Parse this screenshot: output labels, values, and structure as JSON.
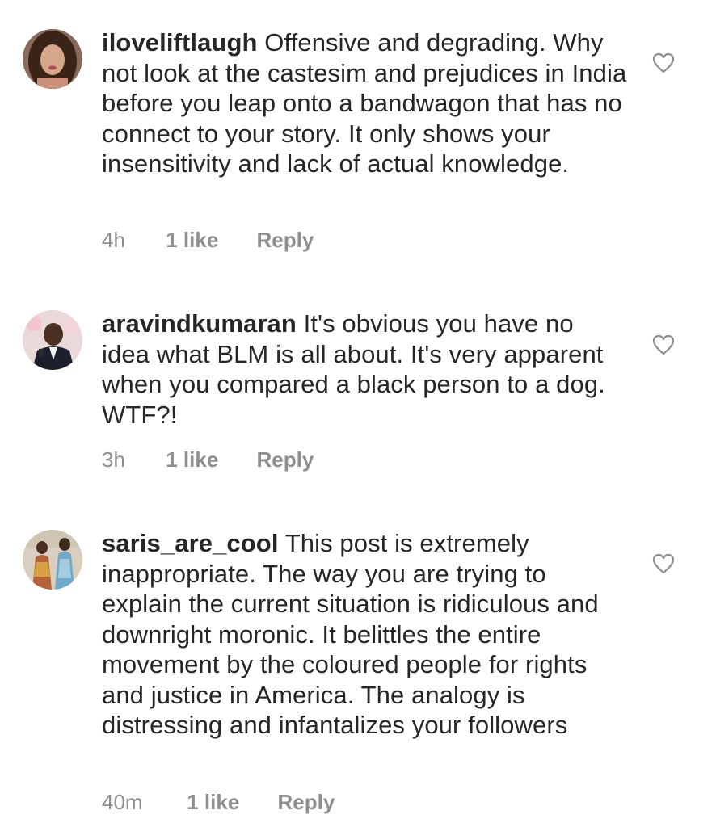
{
  "comments": [
    {
      "username": "iloveliftlaugh",
      "text": "Offensive and degrading. Why not look at the castesim and prejudices in India before you leap onto a bandwagon that has no connect to your story. It only shows your insensitivity and lack of actual knowledge.",
      "time": "4h",
      "likes": "1 like",
      "reply": "Reply"
    },
    {
      "username": "aravindkumaran",
      "text": "It's obvious you have no idea what BLM is all about. It's very apparent when you compared a black person to a dog. WTF?!",
      "time": "3h",
      "likes": "1 like",
      "reply": "Reply"
    },
    {
      "username": "saris_are_cool",
      "text": "This post is extremely inappropriate. The way you are trying to explain the current situation is ridiculous and downright moronic. It belittles the entire movement by the coloured people for rights and justice in America. The analogy is distressing and infantalizes your followers",
      "time": "40m",
      "likes": "1 like",
      "reply": "Reply"
    }
  ],
  "icons": {
    "like": "heart-outline-icon"
  },
  "colors": {
    "text": "#262626",
    "meta": "#8e8e8e"
  }
}
